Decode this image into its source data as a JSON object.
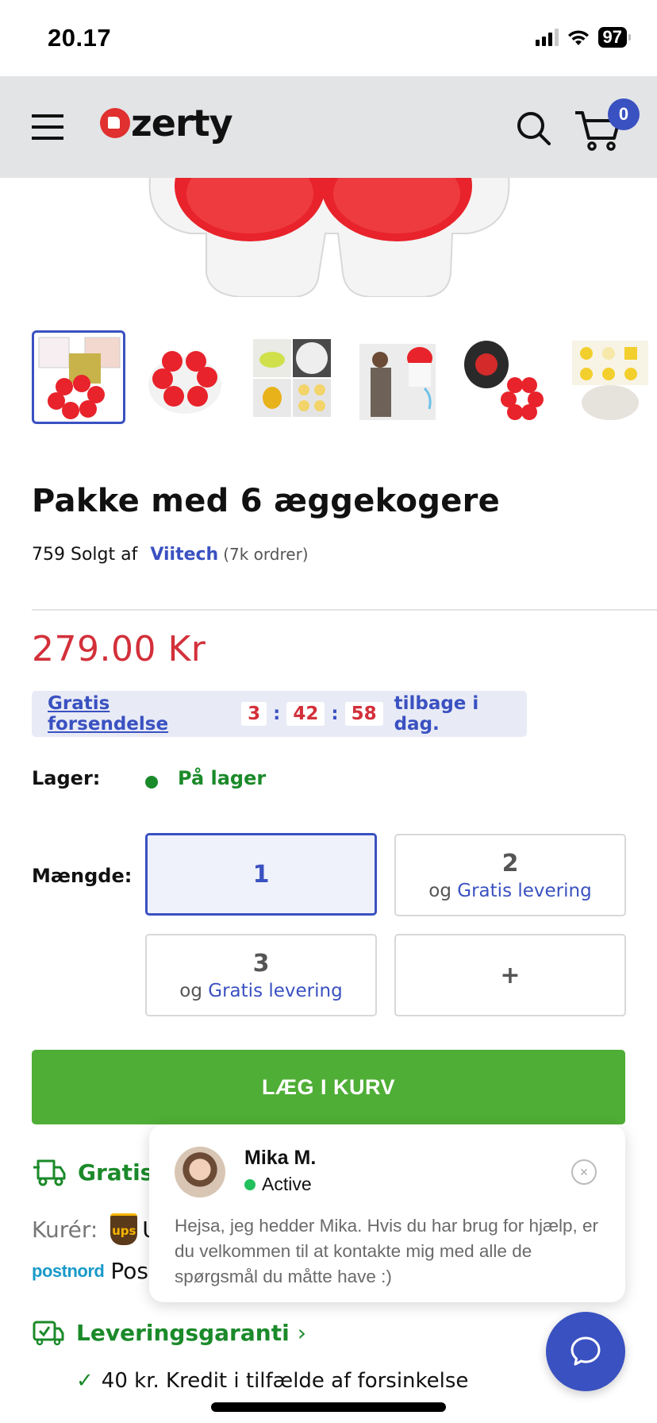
{
  "status_bar": {
    "time": "20.17",
    "battery": "97"
  },
  "header": {
    "logo_text": "zerty",
    "cart_count": "0",
    "icons": [
      "menu-icon",
      "search-icon",
      "cart-icon"
    ]
  },
  "gallery": {
    "thumbnail_count": 6,
    "active_index": 0
  },
  "product": {
    "title": "Pakke med 6 æggekogere",
    "sold_count_text": "759 Solgt af",
    "seller": "Viitech",
    "seller_orders": "(7k ordrer)",
    "price": "279.00 Kr"
  },
  "shipping_banner": {
    "link_text": "Gratis forsendelse",
    "hours": "3",
    "minutes": "42",
    "seconds": "58",
    "separator": ":",
    "tail_text": "tilbage i dag."
  },
  "stock": {
    "label": "Lager:",
    "value": "På lager",
    "color": "#1b8a2a"
  },
  "quantity": {
    "label": "Mængde:",
    "options": [
      {
        "value": "1",
        "prefix": "",
        "bonus": "",
        "selected": true
      },
      {
        "value": "2",
        "prefix": "og",
        "bonus": "Gratis levering",
        "selected": false
      },
      {
        "value": "3",
        "prefix": "og",
        "bonus": "Gratis levering",
        "selected": false
      },
      {
        "value": "+",
        "prefix": "",
        "bonus": "",
        "selected": false
      }
    ]
  },
  "add_to_cart": {
    "label": "LÆG I KURV",
    "color": "#4fae36"
  },
  "delivery": {
    "free_shipping_label": "Gratis",
    "courier_label": "Kurér:",
    "ups_logo": "ups",
    "ups_name_partial": "U",
    "postnord_logo": "postnord",
    "postnord_name_partial": "Pos"
  },
  "guarantee": {
    "label": "Leveringsgaranti",
    "chevron": "›",
    "bullets": [
      "40 kr. Kredit i tilfælde af forsinkelse"
    ]
  },
  "chat_popup": {
    "agent_name": "Mika M.",
    "agent_status": "Active",
    "message": "Hejsa, jeg hedder Mika. Hvis du har brug for hjælp, er du velkommen til at kontakte mig med alle de spørgsmål du måtte have :)",
    "close_glyph": "×"
  },
  "colors": {
    "brand_blue": "#3a51c1",
    "price_red": "#d3303a",
    "green": "#1b8a2a",
    "header_bg": "#e2e4e6"
  }
}
